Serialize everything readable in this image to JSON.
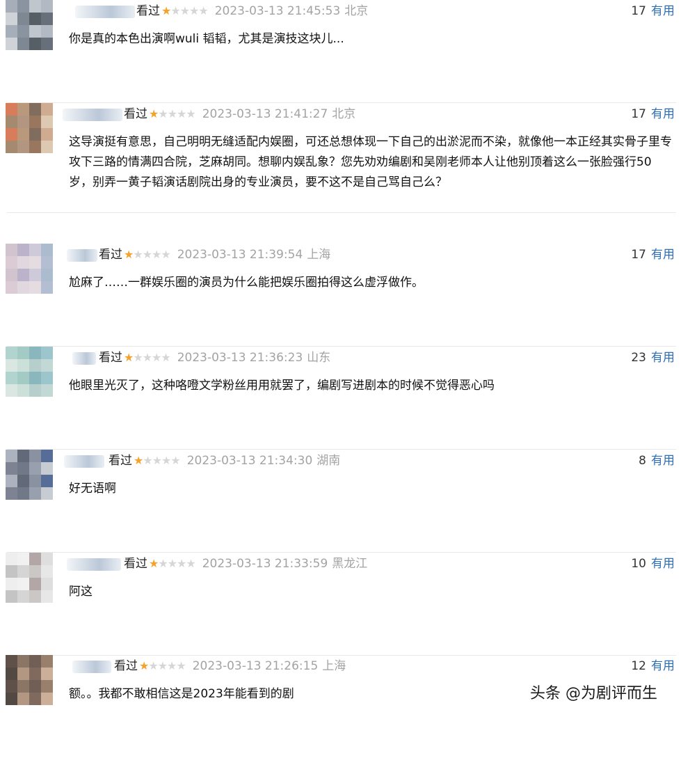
{
  "reviews": [
    {
      "watched_label": "看过",
      "stars": 1,
      "max_stars": 5,
      "time": "2023-03-13 21:45:53",
      "location": "北京",
      "useful_count": "17",
      "useful_label": "有用",
      "content": "你是真的本色出演啊wuli 韬韬，尤其是演技这块儿..."
    },
    {
      "watched_label": "看过",
      "stars": 1,
      "max_stars": 5,
      "time": "2023-03-13 21:41:27",
      "location": "北京",
      "useful_count": "17",
      "useful_label": "有用",
      "content": "这导演挺有意思，自己明明无缝适配内娱圈，可还总想体现一下自己的出淤泥而不染，就像他一本正经其实骨子里专攻下三路的情满四合院，芝麻胡同。想聊内娱乱象？您先劝劝编剧和吴刚老师本人让他别顶着这么一张脸强行50岁，别弄一黄子韬演话剧院出身的专业演员，要不这不是自己骂自己么？"
    },
    {
      "watched_label": "看过",
      "stars": 1,
      "max_stars": 5,
      "time": "2023-03-13 21:39:54",
      "location": "上海",
      "useful_count": "17",
      "useful_label": "有用",
      "content": "尬麻了……一群娱乐圈的演员为什么能把娱乐圈拍得这么虚浮做作。"
    },
    {
      "watched_label": "看过",
      "stars": 1,
      "max_stars": 5,
      "time": "2023-03-13 21:36:23",
      "location": "山东",
      "useful_count": "23",
      "useful_label": "有用",
      "content": "他眼里光灭了，这种咯噔文学粉丝用用就罢了，编剧写进剧本的时候不觉得恶心吗"
    },
    {
      "watched_label": "看过",
      "stars": 1,
      "max_stars": 5,
      "time": "2023-03-13 21:34:30",
      "location": "湖南",
      "useful_count": "8",
      "useful_label": "有用",
      "content": "好无语啊"
    },
    {
      "watched_label": "看过",
      "stars": 1,
      "max_stars": 5,
      "time": "2023-03-13 21:33:59",
      "location": "黑龙江",
      "useful_count": "10",
      "useful_label": "有用",
      "content": "阿这"
    },
    {
      "watched_label": "看过",
      "stars": 1,
      "max_stars": 5,
      "time": "2023-03-13 21:26:15",
      "location": "上海",
      "useful_count": "12",
      "useful_label": "有用",
      "content": "额。。我都不敢相信这是2023年能看到的剧"
    }
  ],
  "watermark": "头条 @为剧评而生",
  "colors": {
    "star_on": "#f4a22c",
    "star_off": "#d6d6d6",
    "useful_link": "#2f6eb5",
    "meta_gray": "#a3a3a3"
  }
}
